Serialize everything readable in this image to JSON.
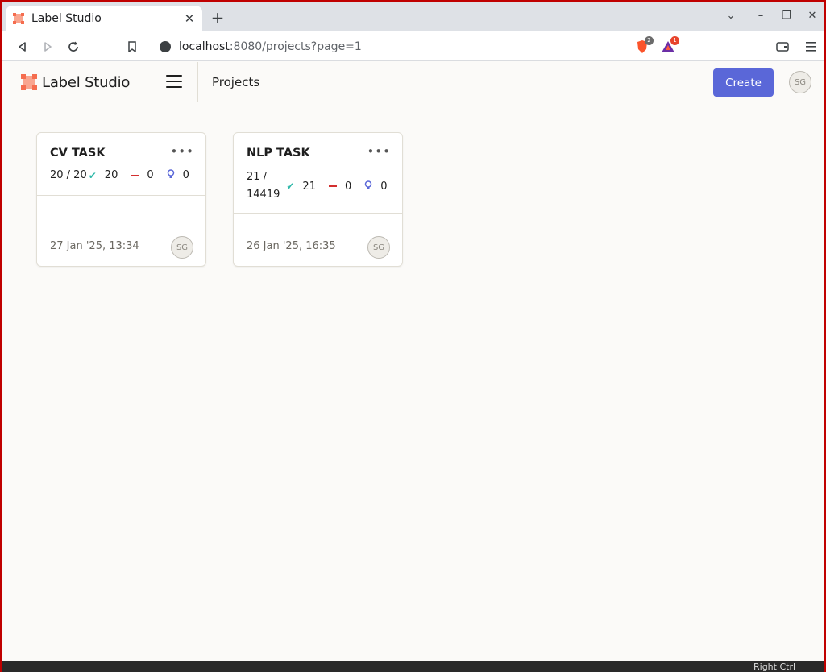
{
  "browser": {
    "tab_title": "Label Studio",
    "url_host": "localhost",
    "url_rest": ":8080/projects?page=1",
    "brave_badge": "2",
    "rewards_badge": "1"
  },
  "header": {
    "brand": "Label Studio",
    "page_title": "Projects",
    "create_label": "Create",
    "user_initials": "SG"
  },
  "projects": [
    {
      "title": "CV TASK",
      "progress_line1": "20 / 20",
      "progress_line2": "",
      "completed": "20",
      "skipped": "0",
      "predictions": "0",
      "date": "27 Jan '25, 13:34",
      "owner_initials": "SG"
    },
    {
      "title": "NLP TASK",
      "progress_line1": "21 /",
      "progress_line2": "14419",
      "completed": "21",
      "skipped": "0",
      "predictions": "0",
      "date": "26 Jan '25, 16:35",
      "owner_initials": "SG"
    }
  ],
  "taskbar": {
    "text": "Right Ctrl"
  },
  "colors": {
    "accent": "#5a67d8",
    "brand": "#f56d4f",
    "completed": "#2eb8a9",
    "skipped": "#d32f2f"
  }
}
